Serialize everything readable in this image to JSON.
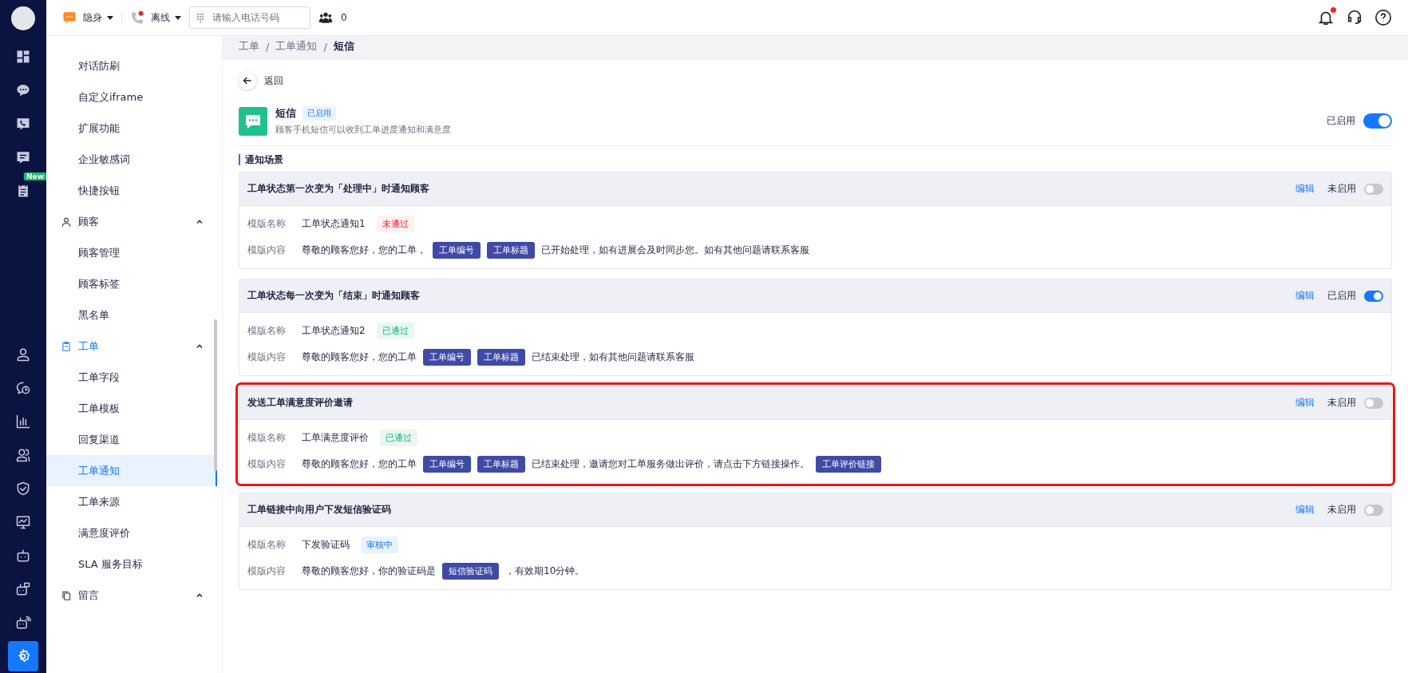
{
  "rail": {
    "top": [
      {
        "selected": false
      },
      {
        "selected": false
      },
      {
        "selected": false
      },
      {
        "selected": false
      },
      {
        "selected": false,
        "badge": "New"
      }
    ],
    "bottom": [
      {
        "selected": false
      },
      {
        "selected": false
      },
      {
        "selected": false
      },
      {
        "selected": false
      },
      {
        "selected": false
      },
      {
        "selected": false
      },
      {
        "selected": false
      },
      {
        "selected": false
      },
      {
        "selected": false
      },
      {
        "selected": true
      }
    ]
  },
  "topbar": {
    "presence": {
      "label": "隐身"
    },
    "line_status": {
      "label": "离线"
    },
    "phone_field": {
      "placeholder": "请输入电话号码"
    },
    "online_count": "0",
    "notifications_unread": true
  },
  "menu": [
    {
      "kind": "item",
      "label": "对话防刷",
      "selected": false
    },
    {
      "kind": "item",
      "label": "自定义iframe",
      "selected": false
    },
    {
      "kind": "item",
      "label": "扩展功能",
      "selected": false
    },
    {
      "kind": "item",
      "label": "企业敏感词",
      "selected": false
    },
    {
      "kind": "item",
      "label": "快捷按钮",
      "selected": false
    },
    {
      "label": "顾客",
      "kind": "person",
      "expanded": true,
      "selected": false,
      "children": [
        {
          "label": "顾客管理",
          "selected": false
        },
        {
          "label": "顾客标签",
          "selected": false
        },
        {
          "label": "黑名单",
          "selected": false
        }
      ]
    },
    {
      "label": "工单",
      "kind": "clipboard",
      "expanded": true,
      "selected": true,
      "children": [
        {
          "label": "工单字段",
          "selected": false
        },
        {
          "label": "工单模板",
          "selected": false
        },
        {
          "label": "回复渠道",
          "selected": false
        },
        {
          "label": "工单通知",
          "selected": true
        },
        {
          "label": "工单来源",
          "selected": false
        },
        {
          "label": "满意度评价",
          "selected": false
        },
        {
          "label": "SLA 服务目标",
          "selected": false
        }
      ]
    },
    {
      "label": "留言",
      "kind": "copy",
      "expanded": true,
      "selected": false
    }
  ],
  "breadcrumb": {
    "separator": "/",
    "items": [
      {
        "label": "工单",
        "current": false
      },
      {
        "label": "工单通知",
        "current": false
      },
      {
        "label": "短信",
        "current": true
      }
    ]
  },
  "back": {
    "label": "返回"
  },
  "channel": {
    "name": "短信",
    "tag": "已启用",
    "description": "顾客手机短信可以收到工单进度通知和满意度",
    "switch_label": "已启用",
    "on": true
  },
  "section_title": "通知场景",
  "scenes": [
    {
      "title": "工单状态第一次变为「处理中」时通知顾客",
      "edit": "编辑",
      "switch_label": "未启用",
      "on": false,
      "highlighted": false,
      "name_label": "模版名称",
      "template_name": "工单状态通知1",
      "status": {
        "kind": "rejected",
        "label": "未通过"
      },
      "content_label": "模版内容",
      "content": [
        {
          "kind": "text",
          "text": "尊敬的顾客您好，您的工单，"
        },
        {
          "kind": "token",
          "text": "工单编号"
        },
        {
          "kind": "token",
          "text": "工单标题"
        },
        {
          "kind": "text",
          "text": "已开始处理，如有进展会及时同步您。如有其他问题请联系客服"
        }
      ]
    },
    {
      "title": "工单状态每一次变为「结束」时通知顾客",
      "edit": "编辑",
      "switch_label": "已启用",
      "on": true,
      "highlighted": false,
      "name_label": "模版名称",
      "template_name": "工单状态通知2",
      "status": {
        "kind": "approved",
        "label": "已通过"
      },
      "content_label": "模版内容",
      "content": [
        {
          "kind": "text",
          "text": "尊敬的顾客您好，您的工单"
        },
        {
          "kind": "token",
          "text": "工单编号"
        },
        {
          "kind": "token",
          "text": "工单标题"
        },
        {
          "kind": "text",
          "text": "已结束处理，如有其他问题请联系客服"
        }
      ]
    },
    {
      "title": "发送工单满意度评价邀请",
      "edit": "编辑",
      "switch_label": "未启用",
      "on": false,
      "highlighted": true,
      "name_label": "模版名称",
      "template_name": "工单满意度评价",
      "status": {
        "kind": "approved",
        "label": "已通过"
      },
      "content_label": "模版内容",
      "content": [
        {
          "kind": "text",
          "text": "尊敬的顾客您好，您的工单"
        },
        {
          "kind": "token",
          "text": "工单编号"
        },
        {
          "kind": "token",
          "text": "工单标题"
        },
        {
          "kind": "text",
          "text": "已结束处理，邀请您对工单服务做出评价，请点击下方链接操作。"
        },
        {
          "kind": "token",
          "text": "工单评价链接"
        }
      ]
    },
    {
      "title": "工单链接中向用户下发短信验证码",
      "edit": "编辑",
      "switch_label": "未启用",
      "on": false,
      "highlighted": false,
      "name_label": "模版名称",
      "template_name": "下发验证码",
      "status": {
        "kind": "pending",
        "label": "审核中"
      },
      "content_label": "模版内容",
      "content": [
        {
          "kind": "text",
          "text": "尊敬的顾客您好，你的验证码是"
        },
        {
          "kind": "token",
          "text": "短信验证码"
        },
        {
          "kind": "text",
          "text": "，有效期10分钟。"
        }
      ]
    }
  ]
}
